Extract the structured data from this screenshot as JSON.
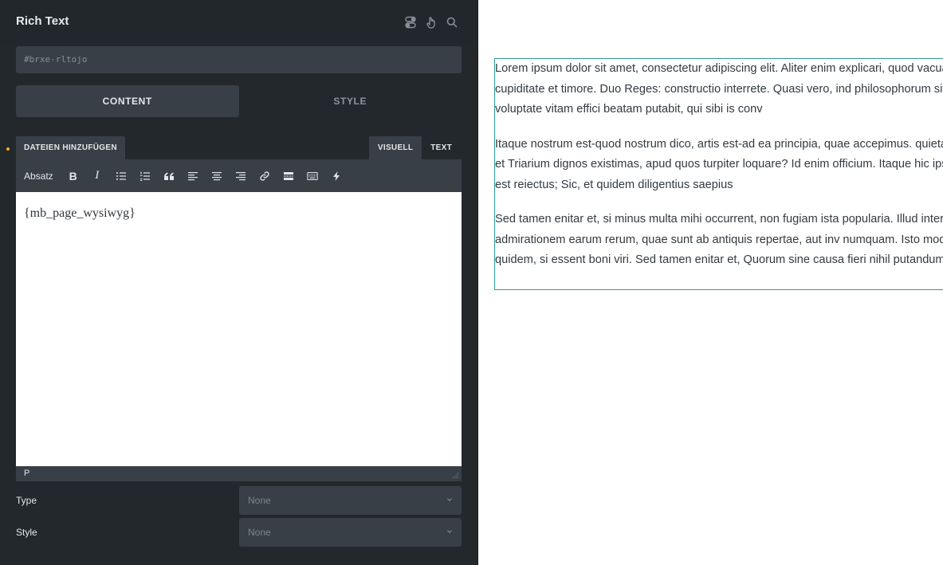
{
  "panel": {
    "title": "Rich Text",
    "element_id": "#brxe-rltojo",
    "tabs": [
      {
        "label": "CONTENT",
        "active": true
      },
      {
        "label": "STYLE",
        "active": false
      }
    ],
    "header_icons": [
      "toggle-icon",
      "pointer-hand-icon",
      "search-icon"
    ]
  },
  "editor": {
    "add_files_label": "DATEIEN HINZUFÜGEN",
    "mode_tabs": [
      {
        "label": "VISUELL",
        "active": true
      },
      {
        "label": "TEXT",
        "active": false
      }
    ],
    "format_select": "Absatz",
    "toolbar_buttons": [
      "bold",
      "italic",
      "bullet-list",
      "numbered-list",
      "blockquote",
      "align-left",
      "align-center",
      "align-right",
      "link",
      "read-more",
      "toolbar-toggle",
      "dynamic-data"
    ],
    "content": "{mb_page_wysiwyg}",
    "status_path": "P"
  },
  "controls": {
    "type": {
      "label": "Type",
      "value": "None"
    },
    "style": {
      "label": "Style",
      "value": "None"
    }
  },
  "preview": {
    "paragraphs": [
      "Lorem ipsum dolor sit amet, consectetur adipiscing elit. Aliter enim explicari, quod vacua infinita cupiditate et timore. Duo Reges: constructio interrete. Quasi vero, ind philosophorum sit. Qui autem voluptate vitam effici beatam putabit, qui sibi is conv",
      "Itaque nostrum est-quod nostrum dico, artis est-ad ea principia, quae accepimus. quieta. Mene ergo et Triarium dignos existimas, apud quos turpiter loquare? Id enim officium. Itaque hic ipse iam pridem est reiectus; Sic, et quidem diligentius saepius",
      "Sed tamen enitar et, si minus multa mihi occurrent, non fugiam ista popularia. Illud intermittunt aut admirationem earum rerum, quae sunt ab antiquis repertae, aut inv numquam. Isto modo ne improbos quidem, si essent boni viri. Sed tamen enitar et, Quorum sine causa fieri nihil putandum est."
    ]
  },
  "colors": {
    "panel_bg": "#23282d",
    "control_bg": "#383f46",
    "accent_dot": "#f0b020",
    "preview_outline": "#2a9d9a"
  }
}
